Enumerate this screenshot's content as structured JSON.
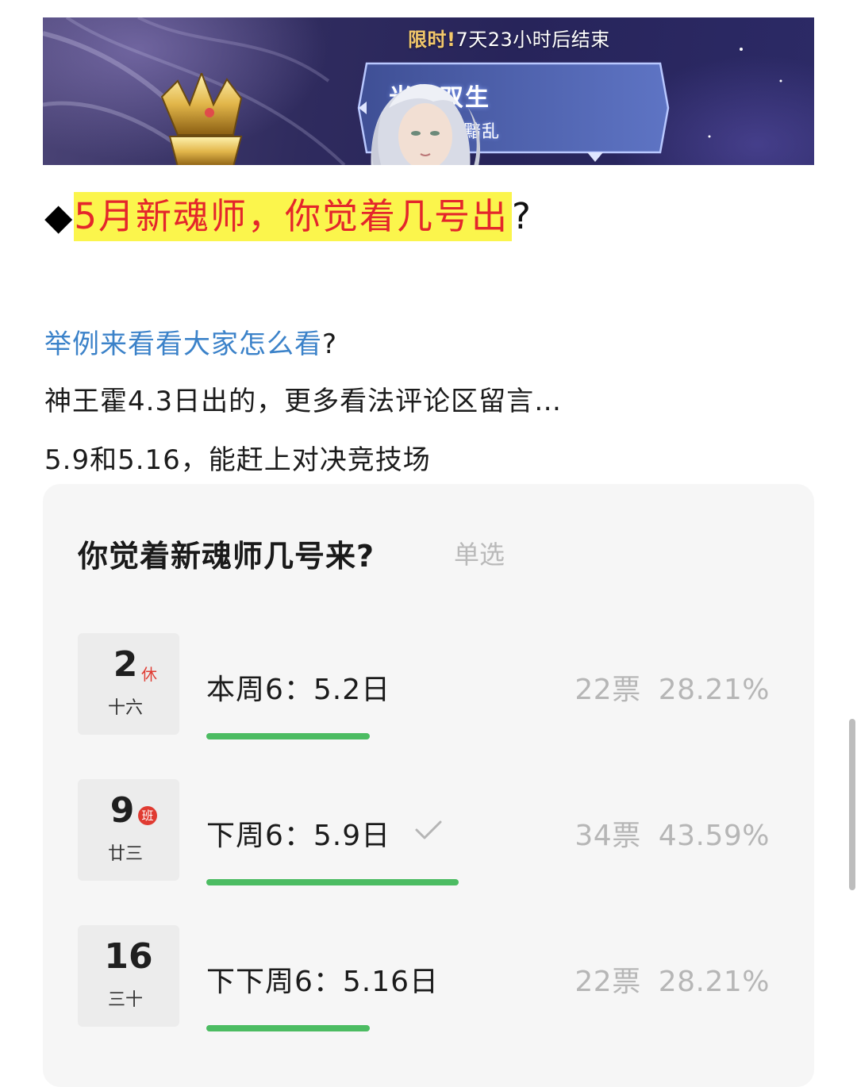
{
  "banner": {
    "timer_prefix": "限时!",
    "timer_text": "7天23小时后结束",
    "skin_name": "光黯双生",
    "skin_subtitle": "立光序破黯乱"
  },
  "heading": {
    "diamond": "◆",
    "highlight": "5月新魂师，你觉着几号出",
    "question_mark": "?"
  },
  "body": {
    "line1_blue": "举例来看看大家怎么看",
    "line1_rest": "?",
    "line2": "神王霍4.3日出的，更多看法评论区留言…",
    "line3": "5.9和5.16，能赶上对决竞技场"
  },
  "poll": {
    "title": "你觉着新魂师几号来?",
    "type": "单选",
    "options": [
      {
        "day": "2",
        "tag": "休",
        "lunar": "十六",
        "label": "本周6：5.2日",
        "votes": "22票",
        "percent": "28.21%",
        "fraction": 0.2821,
        "selected": false
      },
      {
        "day": "9",
        "tag": "班",
        "lunar": "廿三",
        "label": "下周6：5.9日",
        "votes": "34票",
        "percent": "43.59%",
        "fraction": 0.4359,
        "selected": true
      },
      {
        "day": "16",
        "tag": "",
        "lunar": "三十",
        "label": "下下周6：5.16日",
        "votes": "22票",
        "percent": "28.21%",
        "fraction": 0.2821,
        "selected": false
      }
    ]
  },
  "colors": {
    "highlight_bg": "#fbf54c",
    "highlight_text": "#e4262b",
    "link_blue": "#3b82c9",
    "bar_green": "#4cbc62",
    "tag_red": "#e03b32"
  }
}
